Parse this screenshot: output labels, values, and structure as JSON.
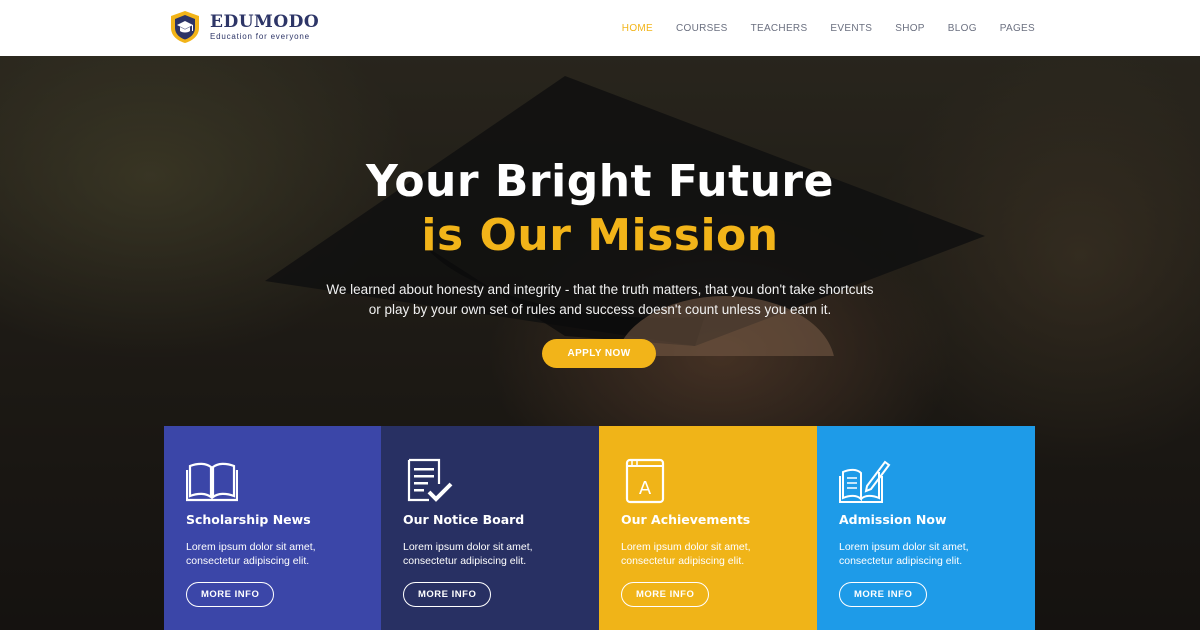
{
  "brand": {
    "name": "EDUMODO",
    "tagline": "Education for everyone",
    "colors": {
      "primary": "#2d3567",
      "accent": "#f2b419"
    }
  },
  "nav": {
    "items": [
      "HOME",
      "COURSES",
      "TEACHERS",
      "EVENTS",
      "SHOP",
      "BLOG",
      "PAGES"
    ],
    "active": "HOME"
  },
  "hero": {
    "title_line1": "Your Bright Future",
    "title_line2": "is Our Mission",
    "lead_line1": "We learned about honesty and integrity - that the truth matters, that you don't take shortcuts",
    "lead_line2": "or play by your own set of rules and success doesn't count unless you earn it.",
    "cta": "APPLY NOW"
  },
  "features": [
    {
      "icon": "open-book-icon",
      "title": "Scholarship News",
      "text_line1": "Lorem ipsum dolor sit amet,",
      "text_line2": "consectetur adipiscing elit.",
      "button": "MORE INFO",
      "color": "#3b46a8"
    },
    {
      "icon": "notice-board-icon",
      "title": "Our Notice Board",
      "text_line1": "Lorem ipsum dolor sit amet,",
      "text_line2": "consectetur adipiscing elit.",
      "button": "MORE INFO",
      "color": "#283063"
    },
    {
      "icon": "achievement-book-icon",
      "title": "Our Achievements",
      "text_line1": "Lorem ipsum dolor sit amet,",
      "text_line2": "consectetur adipiscing elit.",
      "button": "MORE INFO",
      "color": "#f0b418"
    },
    {
      "icon": "admission-pen-icon",
      "title": "Admission Now",
      "text_line1": "Lorem ipsum dolor sit amet,",
      "text_line2": "consectetur adipiscing elit.",
      "button": "MORE INFO",
      "color": "#1e9be8"
    }
  ]
}
